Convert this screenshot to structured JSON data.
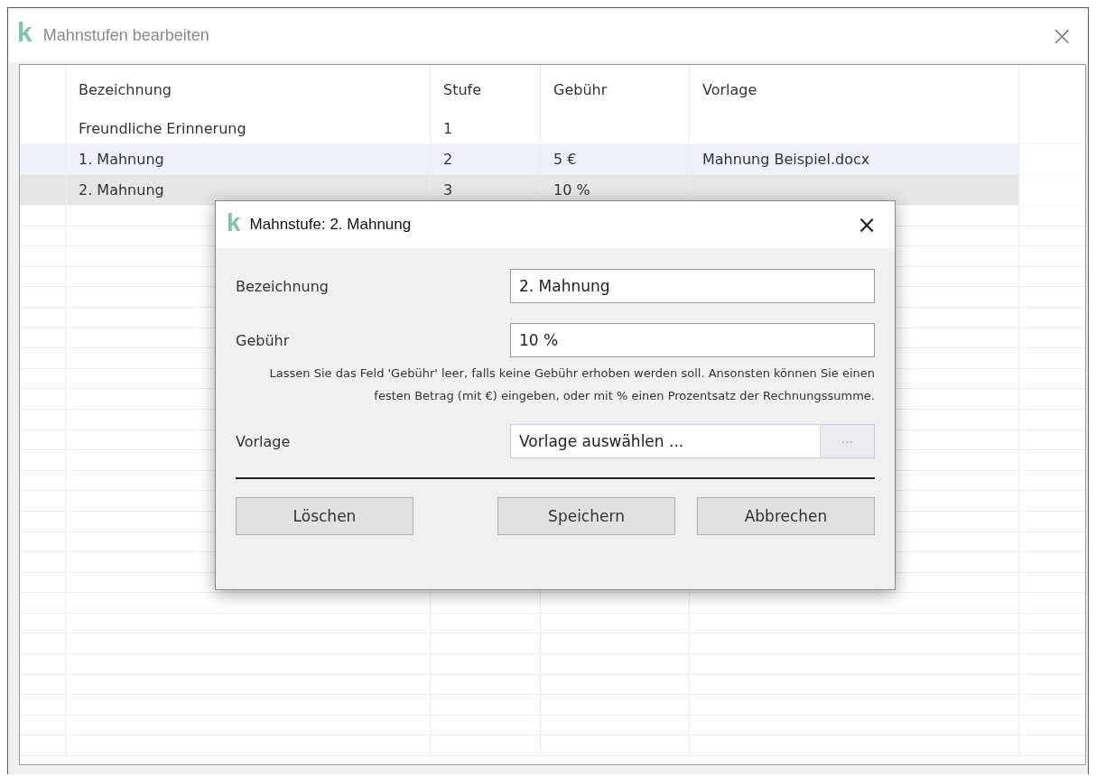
{
  "window": {
    "title": "Mahnstufen bearbeiten",
    "logo": "k",
    "close": "×"
  },
  "table": {
    "columns": [
      "Bezeichnung",
      "Stufe",
      "Gebühr",
      "Vorlage"
    ],
    "rows": [
      {
        "cells": [
          "Freundliche Erinnerung",
          "1",
          "",
          ""
        ],
        "hovered": false,
        "selected": false
      },
      {
        "cells": [
          "1. Mahnung",
          "2",
          "5 €",
          "Mahnung Beispiel.docx"
        ],
        "hovered": true,
        "selected": false
      },
      {
        "cells": [
          "2. Mahnung",
          "3",
          "10 %",
          ""
        ],
        "hovered": false,
        "selected": true
      }
    ]
  },
  "dialog": {
    "title": "Mahnstufe: 2. Mahnung",
    "logo": "k",
    "close": "×",
    "fields": [
      {
        "label": "Bezeichnung",
        "value": "2. Mahnung",
        "kind": "text"
      },
      {
        "label": "Gebühr",
        "value": "10 %",
        "kind": "text",
        "hint": "Lassen Sie das Feld 'Gebühr' leer, falls keine Gebühr erhoben werden soll. Ansonsten können Sie einen festen Betrag (mit €) eingeben, oder mit % einen Prozentsatz der Rechnungssumme."
      },
      {
        "label": "Vorlage",
        "value": "Vorlage auswählen ...",
        "kind": "picker",
        "button": "···"
      }
    ],
    "buttons": [
      "Löschen",
      "Speichern",
      "Abbrechen"
    ]
  }
}
